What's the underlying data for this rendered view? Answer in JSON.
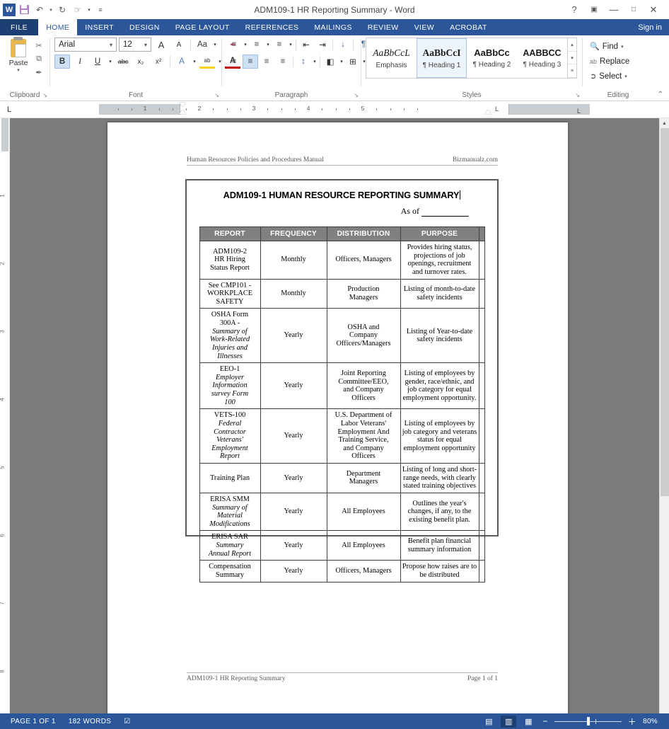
{
  "titlebar": {
    "doc_title": "ADM109-1 HR Reporting Summary - Word",
    "logo": "W",
    "qat": [
      {
        "name": "save-icon",
        "label": "\u0000"
      },
      {
        "name": "undo-icon",
        "label": "↶"
      },
      {
        "name": "redo-icon",
        "label": "↻"
      },
      {
        "name": "touch-mode-icon",
        "label": "✋"
      },
      {
        "name": "customize-qat-icon",
        "label": "▾"
      }
    ],
    "help": "?",
    "ribbon_display": "⬜",
    "minimize": "—",
    "maximize": "❐",
    "close": "✕",
    "signin": "Sign in"
  },
  "tabs": {
    "file": "FILE",
    "items": [
      "HOME",
      "INSERT",
      "DESIGN",
      "PAGE LAYOUT",
      "REFERENCES",
      "MAILINGS",
      "REVIEW",
      "VIEW",
      "ACROBAT"
    ],
    "active": "HOME"
  },
  "ribbon": {
    "clipboard": {
      "label": "Clipboard",
      "paste": "Paste",
      "paste_caret": "▾",
      "cut": "✂",
      "copy": "⧉",
      "format_painter": "✒",
      "launcher": "↘"
    },
    "font": {
      "label": "Font",
      "font_name": "Arial",
      "font_size": "12",
      "caret": "▾",
      "grow_font": "A",
      "shrink_font": "A",
      "change_case": "Aa",
      "clear_formatting": "✒",
      "bold": "B",
      "italic": "I",
      "underline": "U",
      "strikethrough": "abc",
      "subscript": "x₂",
      "superscript": "x²",
      "text_effects": "A",
      "highlight": "ab",
      "font_color": "A",
      "launcher": "↘"
    },
    "paragraph": {
      "label": "Paragraph",
      "bullets": "≡",
      "numbering": "≡",
      "multilevel": "≡",
      "decrease_indent": "⇤",
      "increase_indent": "⇥",
      "sort": "↓",
      "show_marks": "¶",
      "align_left": "≡",
      "align_center": "≡",
      "align_right": "≡",
      "justify": "≡",
      "line_spacing": "↕",
      "shading": "◧",
      "borders": "⊞",
      "launcher": "↘"
    },
    "styles": {
      "label": "Styles",
      "items": [
        {
          "preview": "AaBbCcL",
          "name": "Emphasis",
          "selected": false
        },
        {
          "preview": "AaBbCcI",
          "name": "¶ Heading 1",
          "selected": true
        },
        {
          "preview": "AaBbCc",
          "name": "¶ Heading 2",
          "selected": false
        },
        {
          "preview": "AABBCC",
          "name": "¶ Heading 3",
          "selected": false
        }
      ],
      "scroll_up": "▴",
      "scroll_down": "▾",
      "more": "≡",
      "launcher": "↘"
    },
    "editing": {
      "label": "Editing",
      "find": "Find",
      "find_caret": "▾",
      "replace": "Replace",
      "select": "Select",
      "select_caret": "▾",
      "collapse": "⌃"
    }
  },
  "ruler": {
    "tabstop": "L",
    "numbers": [
      "1",
      "2",
      "3",
      "4",
      "5"
    ],
    "left_marker": "L",
    "right_marker": "L",
    "vertical_numbers": [
      "1",
      "2",
      "3",
      "4",
      "5",
      "6",
      "7",
      "8"
    ]
  },
  "document": {
    "header_left": "Human Resources Policies and Procedures Manual",
    "header_right": "Bizmanualz.com",
    "title": "ADM109-1 HUMAN RESOURCE REPORTING SUMMARY",
    "as_of_label": "As of",
    "footer_left": "ADM109-1 HR Reporting Summary",
    "footer_right": "Page 1 of 1",
    "table": {
      "headers": [
        "REPORT",
        "FREQUENCY",
        "DISTRIBUTION",
        "PURPOSE"
      ],
      "rows": [
        {
          "report_main": "ADM109-2\nHR Hiring\nStatus Report",
          "report_italic": "",
          "frequency": "Monthly",
          "distribution": "Officers, Managers",
          "purpose": "Provides hiring status, projections of job openings, recruitment and turnover rates."
        },
        {
          "report_main": "See CMP101 -\nWORKPLACE\nSAFETY",
          "report_italic": "",
          "frequency": "Monthly",
          "distribution": "Production\nManagers",
          "purpose": "Listing of month-to-date safety incidents"
        },
        {
          "report_main": "OSHA Form\n300A -",
          "report_italic": "Summary of\nWork-Related\nInjuries and\nIllnesses",
          "frequency": "Yearly",
          "distribution": "OSHA and\nCompany\nOfficers/Managers",
          "purpose": "Listing of Year-to-date safety incidents"
        },
        {
          "report_main": "EEO-1",
          "report_italic": "Employer\nInformation\nsurvey Form\n100",
          "frequency": "Yearly",
          "distribution": "Joint Reporting\nCommittee/EEO,\nand Company\nOfficers",
          "purpose": "Listing of employees by gender, race/ethnic, and job category for equal employment opportunity."
        },
        {
          "report_main": "VETS-100",
          "report_italic": "Federal\nContractor\nVeterans'\nEmployment\nReport",
          "frequency": "Yearly",
          "distribution": "U.S. Department of\nLabor Veterans'\nEmployment And\nTraining Service,\nand Company\nOfficers",
          "purpose": "Listing of employees by job category and veterans status for equal employment opportunity"
        },
        {
          "report_main": "Training Plan",
          "report_italic": "",
          "frequency": "Yearly",
          "distribution": "Department\nManagers",
          "purpose": "Listing of long and short-range needs, with clearly stated training objectives"
        },
        {
          "report_main": "ERISA SMM",
          "report_italic": "Summary of\nMaterial\nModifications",
          "frequency": "Yearly",
          "distribution": "All Employees",
          "purpose": "Outlines the year's changes, if any, to the existing benefit plan."
        },
        {
          "report_main": "ERISA SAR",
          "report_italic": "Summary\nAnnual Report",
          "frequency": "Yearly",
          "distribution": "All Employees",
          "purpose": "Benefit plan financial summary information"
        },
        {
          "report_main": "Compensation\nSummary",
          "report_italic": "",
          "frequency": "Yearly",
          "distribution": "Officers, Managers",
          "purpose": "Propose how raises are to be distributed"
        }
      ]
    }
  },
  "statusbar": {
    "page": "PAGE 1 OF 1",
    "words": "182 WORDS",
    "proofing_icon": "☑",
    "read_mode": "▤",
    "print_layout": "▥",
    "web_layout": "▦",
    "zoom_out": "−",
    "zoom_in": "＋",
    "zoom_level": "80%"
  },
  "colors": {
    "accent": "#2b579a",
    "file_tab": "#1e3f73",
    "table_header_bg": "#808080",
    "canvas_bg": "#7b7b7b"
  }
}
